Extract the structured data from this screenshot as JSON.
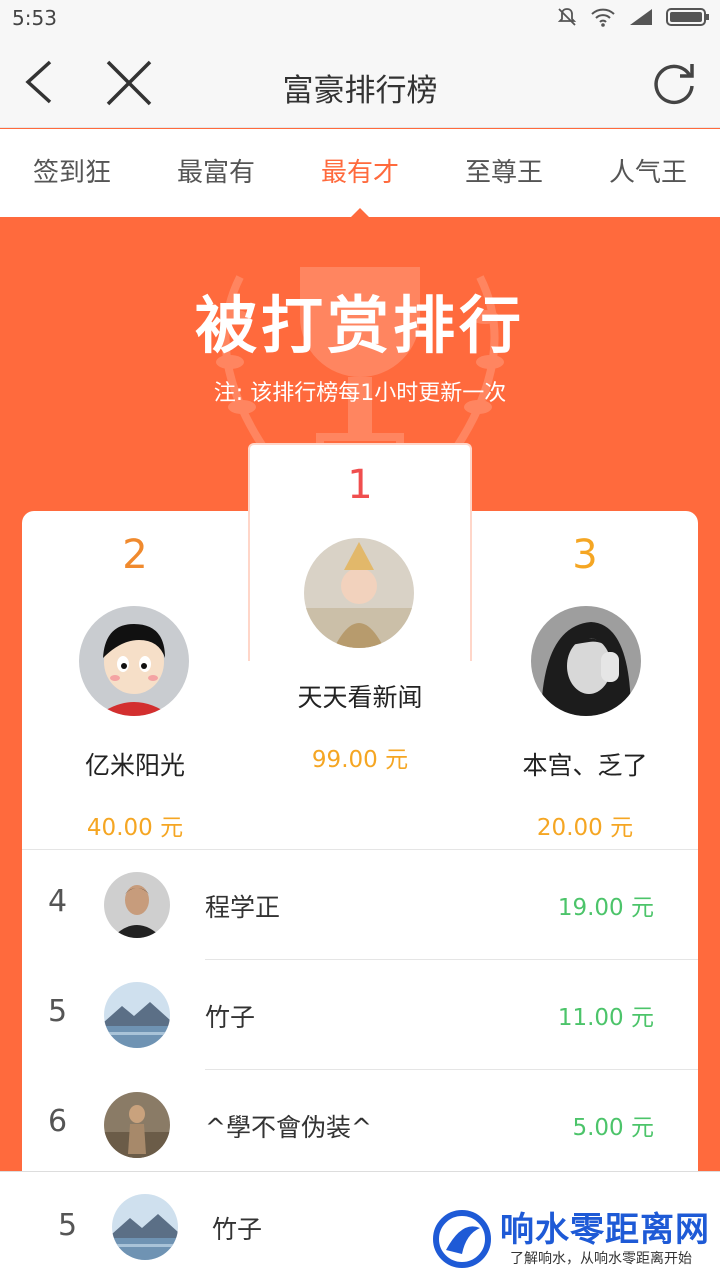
{
  "status": {
    "time": "5:53"
  },
  "nav": {
    "title": "富豪排行榜"
  },
  "tabs": [
    {
      "label": "签到狂"
    },
    {
      "label": "最富有"
    },
    {
      "label": "最有才"
    },
    {
      "label": "至尊王"
    },
    {
      "label": "人气王"
    }
  ],
  "hero": {
    "headline": "被打赏排行",
    "note": "注: 该排行榜每1小时更新一次"
  },
  "podium": {
    "first": {
      "rank": "1",
      "name": "天天看新闻",
      "amount": "99.00 元"
    },
    "second": {
      "rank": "2",
      "name": "亿米阳光",
      "amount": "40.00 元"
    },
    "third": {
      "rank": "3",
      "name": "本宫、乏了",
      "amount": "20.00 元"
    }
  },
  "list": [
    {
      "rank": "4",
      "name": "程学正",
      "amount": "19.00 元"
    },
    {
      "rank": "5",
      "name": "竹子",
      "amount": "11.00 元"
    },
    {
      "rank": "6",
      "name": "^學不會伪装^",
      "amount": "5.00 元"
    }
  ],
  "footer": {
    "rank": "5",
    "name": "竹子",
    "watermark_title": "响水零距离网",
    "watermark_sub": "了解响水，从响水零距离开始"
  },
  "colors": {
    "accent": "#ff6a3d",
    "gold": "#f5a623",
    "green": "#4cc46a",
    "first_rank": "#f04e4e",
    "second_rank": "#f08a2e"
  }
}
